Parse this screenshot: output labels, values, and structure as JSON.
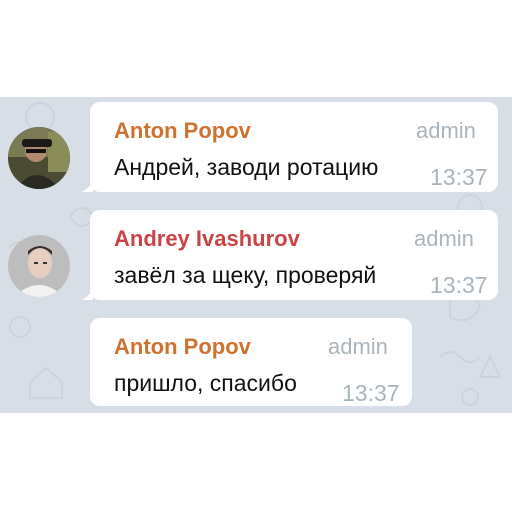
{
  "messages": [
    {
      "sender": "Anton Popov",
      "sender_color": "#d0722f",
      "role": "admin",
      "text": "Андрей, заводи ротацию",
      "time": "13:37",
      "avatar": "avatar-anton"
    },
    {
      "sender": "Andrey Ivashurov",
      "sender_color": "#cc4343",
      "role": "admin",
      "text": "завёл за щеку, проверяй",
      "time": "13:37",
      "avatar": "avatar-andrey"
    },
    {
      "sender": "Anton Popov",
      "sender_color": "#d0722f",
      "role": "admin",
      "text": "пришло, спасибо",
      "time": "13:37",
      "avatar": null
    }
  ]
}
